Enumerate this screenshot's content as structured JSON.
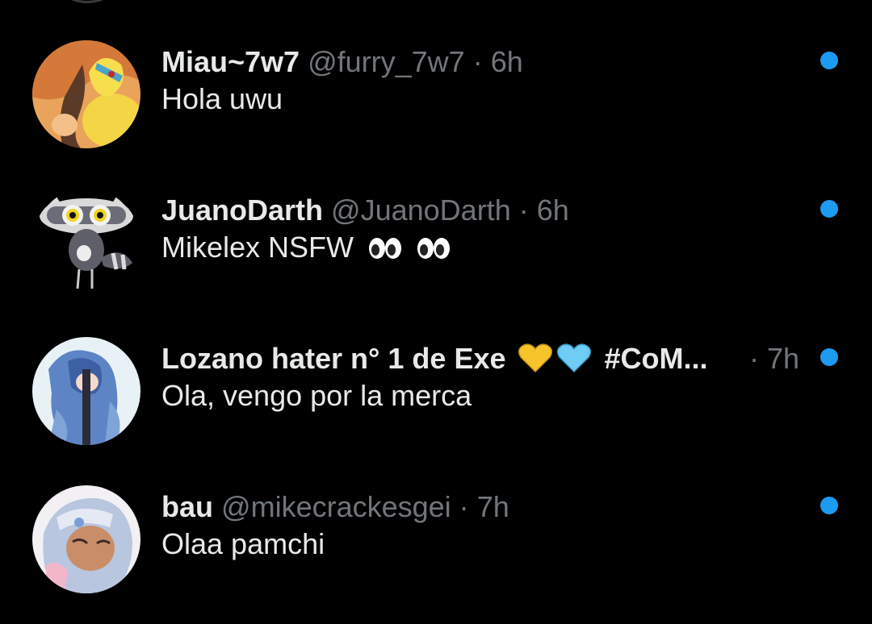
{
  "accent_color": "#1d9bf0",
  "conversations": [
    {
      "display_name": "Miau~7w7",
      "handle": "@furry_7w7",
      "separator": "·",
      "time": "6h",
      "preview": "Hola uwu",
      "unread": true,
      "avatar_icon": "fox-character-avatar"
    },
    {
      "display_name": "JuanoDarth",
      "handle": "@JuanoDarth",
      "separator": "·",
      "time": "6h",
      "preview": "Mikelex NSFW",
      "preview_emoji": [
        "👀",
        "👀"
      ],
      "unread": true,
      "avatar_icon": "raccoon-character-avatar"
    },
    {
      "display_name": "Lozano hater n° 1 de Exe",
      "name_emoji": [
        "💛",
        "🩵"
      ],
      "name_hashtag": "#CoM...",
      "separator": "·",
      "time": "7h",
      "preview": "Ola, vengo por la merca",
      "unread": true,
      "avatar_icon": "blue-hair-character-avatar"
    },
    {
      "display_name": "bau",
      "handle": "@mikecrackesgei",
      "separator": "·",
      "time": "7h",
      "preview": "Olaa pamchi",
      "unread": true,
      "avatar_icon": "hooded-character-avatar"
    }
  ]
}
